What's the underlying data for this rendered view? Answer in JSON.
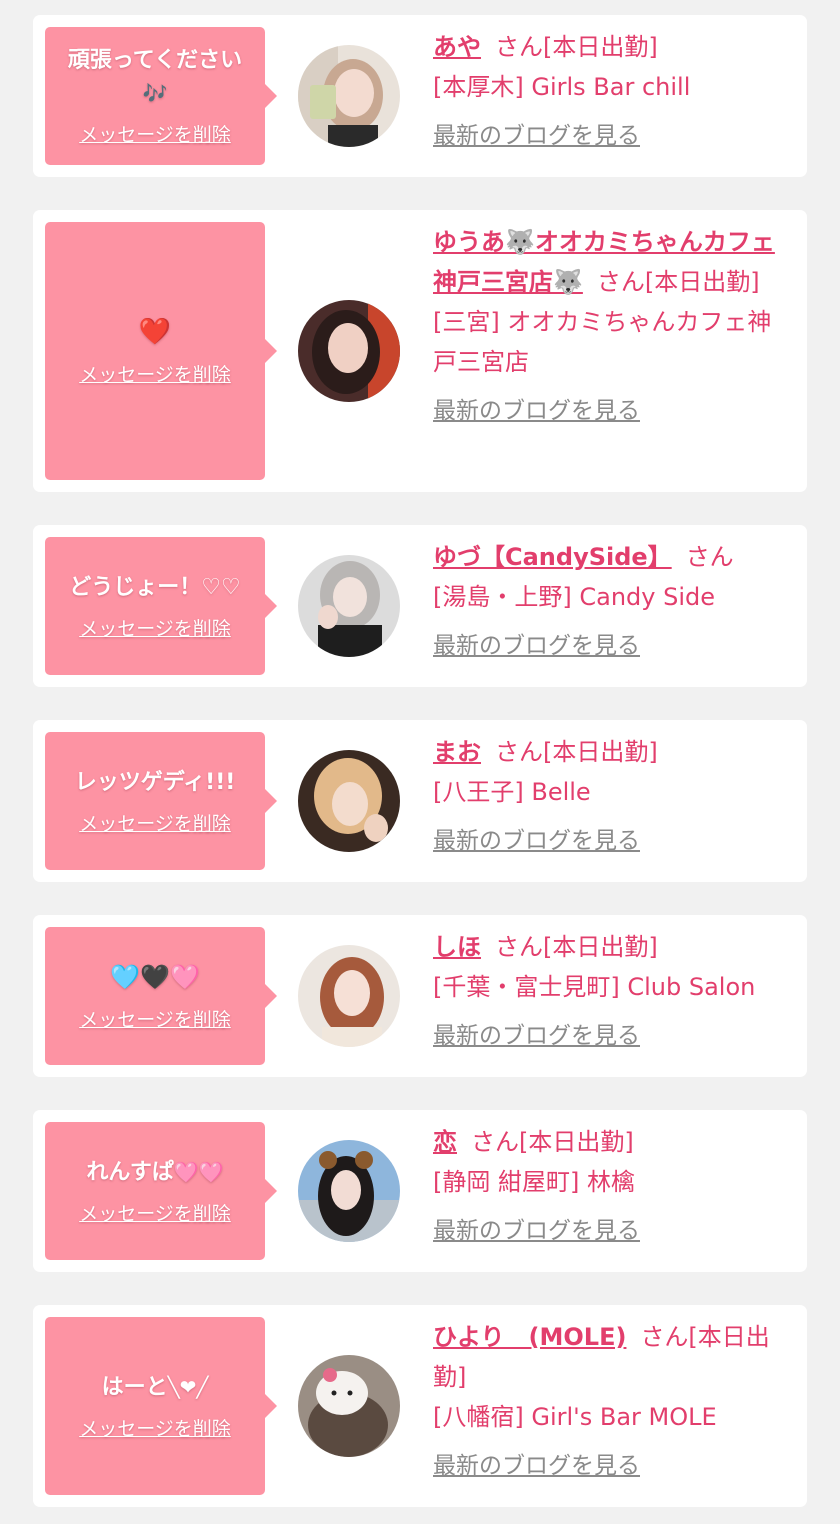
{
  "delete_label": "メッセージを削除",
  "blog_label": "最新のブログを見る",
  "honorific": "さん",
  "working_today": "[本日出勤]",
  "colors": {
    "accent": "#e23e6c",
    "bubble": "#fd93a3",
    "link_gray": "#8a8a8a",
    "page_bg": "#f1f1f1"
  },
  "cards": [
    {
      "message": "頑張ってください",
      "message_emoji": "🎶",
      "name": "あや",
      "status": "さん[本日出勤]",
      "shop": "[本厚木] Girls Bar chill"
    },
    {
      "message": "",
      "message_emoji": "❤️",
      "name": "ゆうあ🐺オオカミちゃんカフェ神戸三宮店🐺",
      "status": "さん[本日出勤]",
      "shop": "[三宮] オオカミちゃんカフェ神戸三宮店"
    },
    {
      "message": "どうじょー！♡♡",
      "message_emoji": "",
      "name": "ゆづ【CandySide】",
      "status": "さん",
      "shop": "[湯島・上野] Candy Side"
    },
    {
      "message": "レッツゲディ!!!",
      "message_emoji": "",
      "name": "まお",
      "status": "さん[本日出勤]",
      "shop": "[八王子] Belle"
    },
    {
      "message": "",
      "message_emoji": "🩵🖤🩷",
      "name": "しほ",
      "status": "さん[本日出勤]",
      "shop": "[千葉・富士見町] Club Salon"
    },
    {
      "message": "れんすぱ",
      "message_emoji": "🩷🩷",
      "name": "恋",
      "status": "さん[本日出勤]",
      "shop": "[静岡 紺屋町] 林檎"
    },
    {
      "message": "はーと",
      "message_emoji": "╲❤╱",
      "name": "ひより　(MOLE)",
      "status": "さん[本日出勤]",
      "shop": "[八幡宿] Girl's Bar MOLE"
    }
  ]
}
